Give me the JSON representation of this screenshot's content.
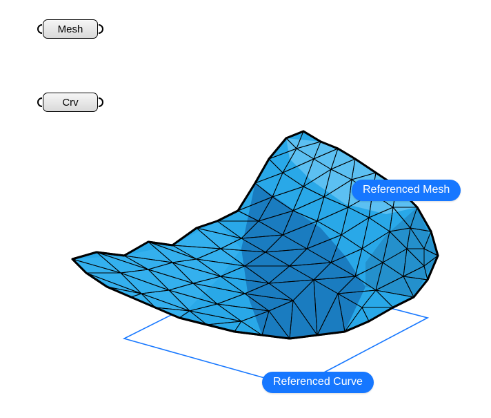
{
  "params": {
    "mesh": {
      "label": "Mesh"
    },
    "curve": {
      "label": "Crv"
    }
  },
  "labels": {
    "mesh": "Referenced Mesh",
    "curve": "Referenced Curve"
  },
  "colors": {
    "mesh_fill": "#29a8e8",
    "mesh_shade": "#1a7cc0",
    "mesh_highlight": "#5cc0f2",
    "mesh_wire": "#000000",
    "curve_stroke": "#1677ff",
    "pill_bg": "#1677ff"
  }
}
